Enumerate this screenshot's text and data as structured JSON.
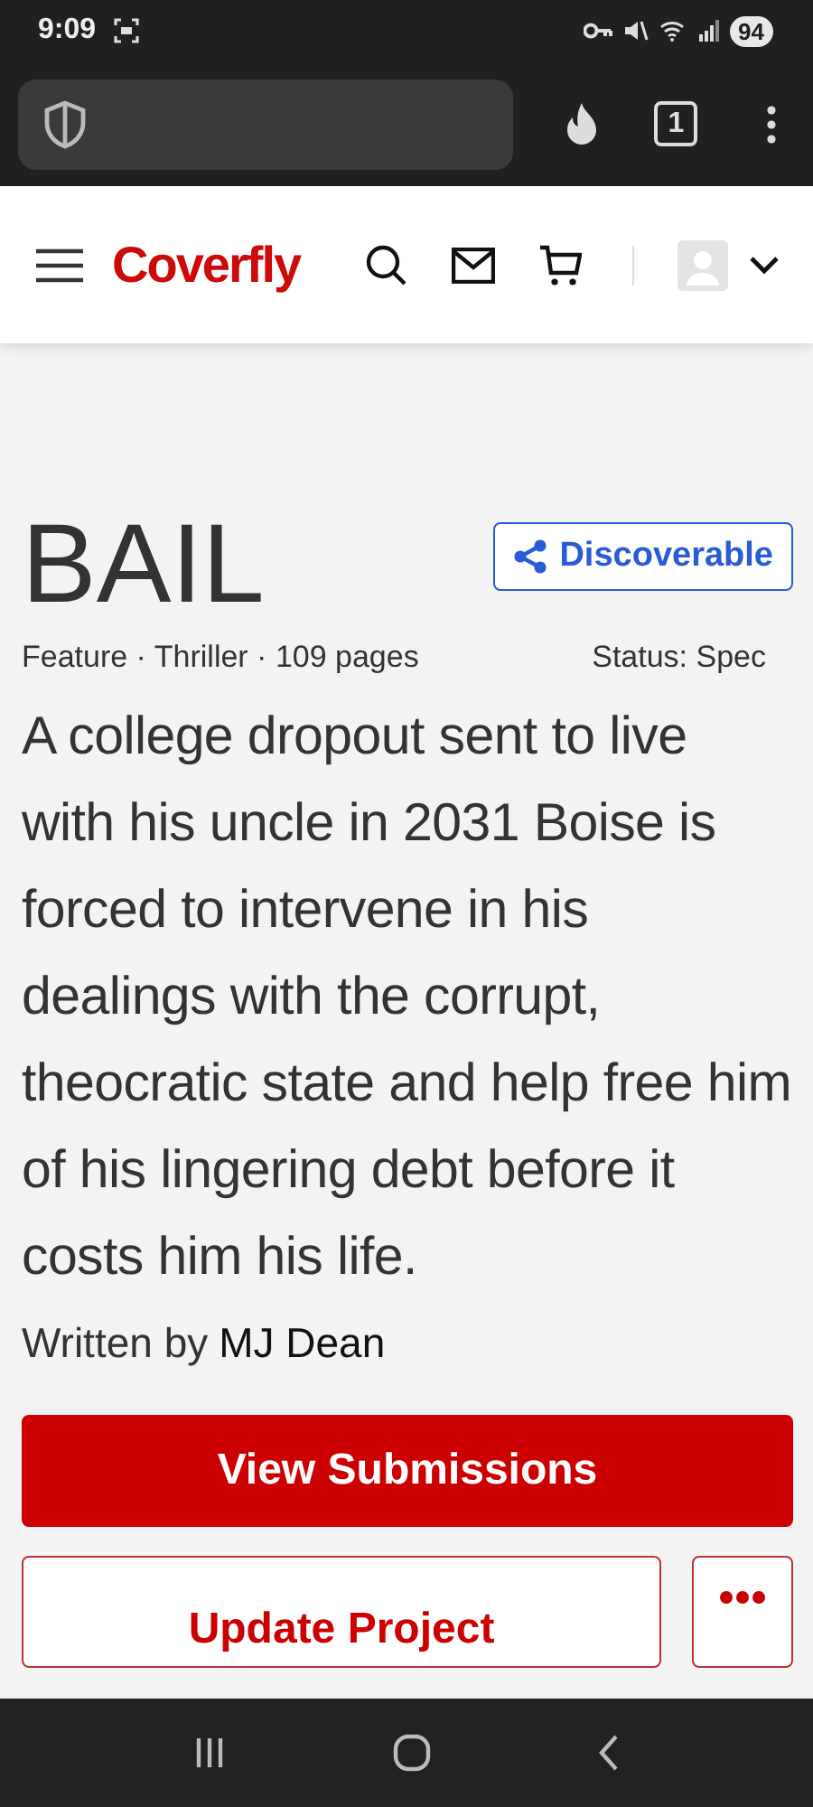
{
  "status_bar": {
    "time": "9:09",
    "battery": "94"
  },
  "browser": {
    "tab_count": "1"
  },
  "header": {
    "logo": "Coverfly"
  },
  "project": {
    "title": "BAIL",
    "visibility": "Discoverable",
    "meta": "Feature · Thriller · 109 pages",
    "status": "Status: Spec",
    "logline": "A college dropout sent to live with his uncle in 2031 Boise is forced to intervene in his dealings with the corrupt, theocratic state and help free him of his lingering debt before it costs him his life.",
    "written_by_label": "Written by",
    "author": "MJ Dean"
  },
  "actions": {
    "primary": "View Submissions",
    "secondary": "Update Project"
  }
}
